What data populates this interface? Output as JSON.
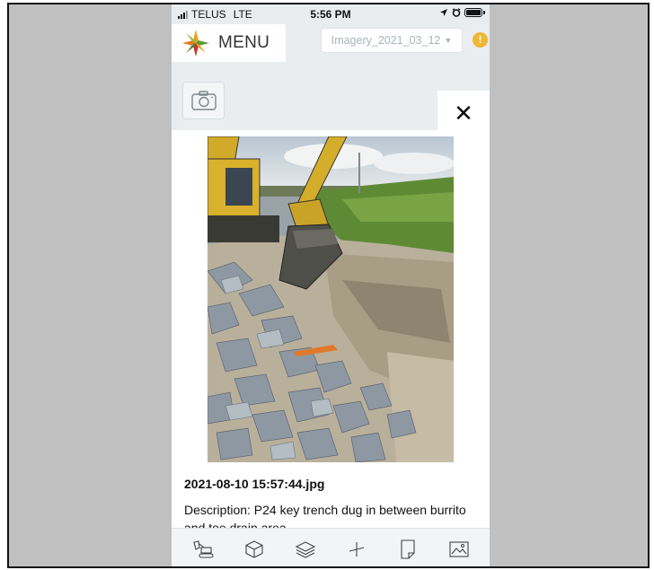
{
  "status_bar": {
    "carrier": "TELUS",
    "network": "LTE",
    "time": "5:56 PM"
  },
  "header": {
    "menu_label": "MENU",
    "imagery_selected": "Imagery_2021_03_12",
    "alert_symbol": "!"
  },
  "modal": {
    "close_symbol": "✕",
    "file_name": "2021-08-10 15:57:44.jpg",
    "description": "Description: P24 key trench dug in between burrito and toe drain area"
  },
  "toolbar": {
    "icons": [
      "excavator-icon",
      "cube-icon",
      "layers-icon",
      "measure-icon",
      "note-icon",
      "image-icon"
    ]
  },
  "colors": {
    "alert": "#f0b531",
    "menu_bg": "#ffffff",
    "app_bg": "#e9edf0"
  }
}
